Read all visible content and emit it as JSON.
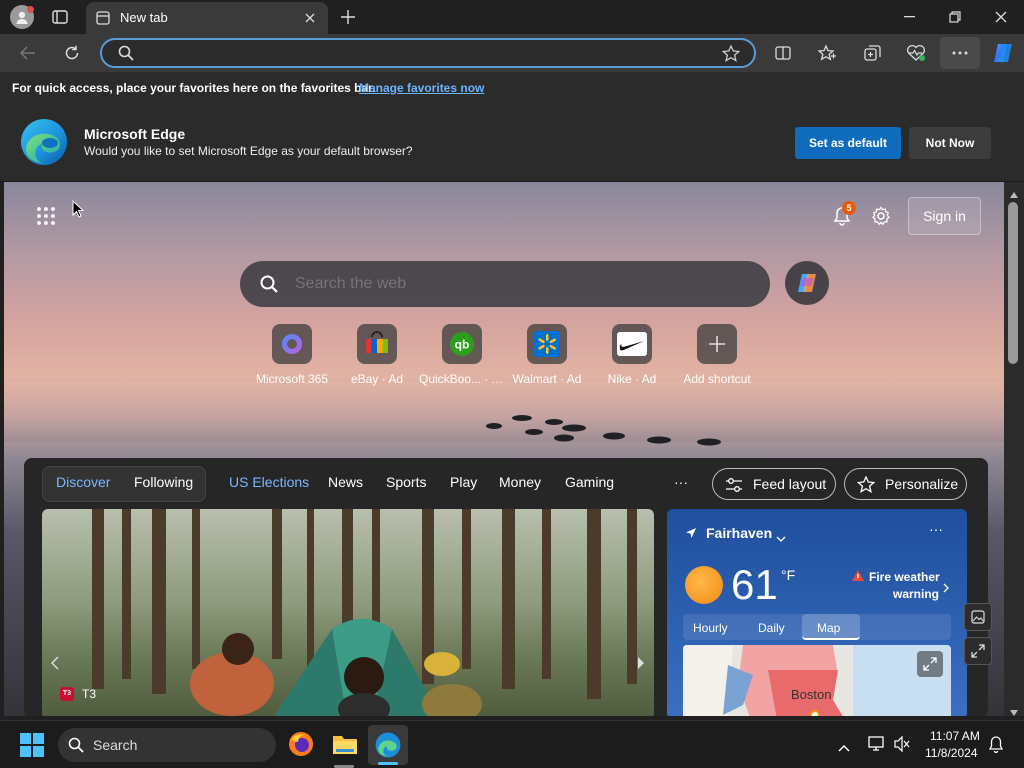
{
  "browser": {
    "tab_title": "New tab",
    "address_value": "",
    "favbar_text": "For quick access, place your favorites here on the favorites bar.",
    "favbar_link": "Manage favorites now"
  },
  "infobar": {
    "title": "Microsoft Edge",
    "message": "Would you like to set Microsoft Edge as your default browser?",
    "set_default": "Set as default",
    "not_now": "Not Now"
  },
  "newtab": {
    "notification_count": "5",
    "sign_in": "Sign in",
    "search_placeholder": "Search the web",
    "shortcuts": [
      {
        "label": "Microsoft 365",
        "icon": "microsoft-365-icon"
      },
      {
        "label": "eBay · Ad",
        "icon": "ebay-icon"
      },
      {
        "label": "QuickBoo... · Ad",
        "icon": "quickbooks-icon"
      },
      {
        "label": "Walmart · Ad",
        "icon": "walmart-icon"
      },
      {
        "label": "Nike · Ad",
        "icon": "nike-icon"
      },
      {
        "label": "Add shortcut",
        "icon": "plus-icon"
      }
    ]
  },
  "feed": {
    "tabs": [
      "Discover",
      "Following",
      "US Elections",
      "News",
      "Sports",
      "Play",
      "Money",
      "Gaming"
    ],
    "more": "···",
    "feed_layout": "Feed layout",
    "personalize": "Personalize",
    "article_source": "T3"
  },
  "weather": {
    "location": "Fairhaven",
    "temp": "61",
    "unit": "°F",
    "alert_line1": "Fire weather",
    "alert_line2": "warning",
    "tabs": [
      "Hourly",
      "Daily",
      "Map"
    ],
    "active_tab": "Map",
    "map_city": "Boston"
  },
  "taskbar": {
    "search_label": "Search",
    "time": "11:07 AM",
    "date": "11/8/2024"
  },
  "colors": {
    "accent_blue": "#0f6cbd",
    "link_blue": "#6cb4ff",
    "badge_orange": "#e8590c",
    "weather_card": "#2a5aa8"
  }
}
